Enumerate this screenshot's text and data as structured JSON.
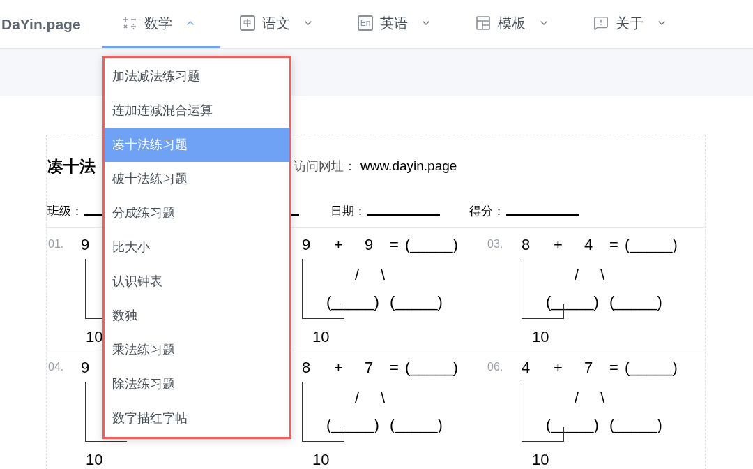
{
  "logo": "DaYin.page",
  "nav": [
    {
      "kind": "math",
      "label": "数学",
      "selected": true,
      "expanded": true
    },
    {
      "kind": "glyph",
      "glyph": "中",
      "label": "语文",
      "selected": false,
      "expanded": false
    },
    {
      "kind": "glyph",
      "glyph": "En",
      "label": "英语",
      "selected": false,
      "expanded": false
    },
    {
      "kind": "template",
      "label": "模板",
      "selected": false,
      "expanded": false
    },
    {
      "kind": "about",
      "label": "关于",
      "selected": false,
      "expanded": false
    }
  ],
  "menu": [
    {
      "label": "加法减法练习题",
      "selected": false
    },
    {
      "label": "连加连减混合运算",
      "selected": false
    },
    {
      "label": "凑十法练习题",
      "selected": true
    },
    {
      "label": "破十法练习题",
      "selected": false
    },
    {
      "label": "分成练习题",
      "selected": false
    },
    {
      "label": "比大小",
      "selected": false
    },
    {
      "label": "认识钟表",
      "selected": false
    },
    {
      "label": "数独",
      "selected": false
    },
    {
      "label": "乘法练习题",
      "selected": false
    },
    {
      "label": "除法练习题",
      "selected": false
    },
    {
      "label": "数字描红字帖",
      "selected": false
    }
  ],
  "sheet": {
    "title": "凑十法",
    "site_label": "访问网址：",
    "site": "www.dayin.page",
    "fields": [
      "班级：",
      "日期：",
      "得分："
    ],
    "problems": [
      {
        "kind": "partial",
        "label": "01.",
        "a": "9",
        "total": "10"
      },
      {
        "kind": "full",
        "a": "9",
        "op": "+",
        "b": "9",
        "eq": "=",
        "answer": "(_____)",
        "slash": "/",
        "backslash": "\\",
        "part1": "(_____)",
        "part2": "(_____)",
        "total": "10"
      },
      {
        "kind": "full",
        "label": "03.",
        "a": "8",
        "op": "+",
        "b": "4",
        "eq": "=",
        "answer": "(_____)",
        "slash": "/",
        "backslash": "\\",
        "part1": "(_____)",
        "part2": "(_____)",
        "total": "10"
      },
      {
        "kind": "partial",
        "label": "04.",
        "a": "9",
        "total": "10"
      },
      {
        "kind": "full",
        "a": "8",
        "op": "+",
        "b": "7",
        "eq": "=",
        "answer": "(_____)",
        "slash": "/",
        "backslash": "\\",
        "part1": "(_____)",
        "part2": "(_____)",
        "total": "10"
      },
      {
        "kind": "full",
        "label": "06.",
        "a": "4",
        "op": "+",
        "b": "7",
        "eq": "=",
        "answer": "(_____)",
        "slash": "/",
        "backslash": "\\",
        "part1": "(_____)",
        "part2": "(_____)",
        "total": "10"
      }
    ]
  }
}
